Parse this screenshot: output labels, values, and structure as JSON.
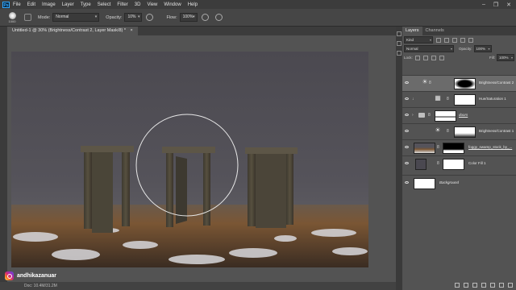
{
  "menubar": {
    "app_logo": "Ps",
    "items": [
      "File",
      "Edit",
      "Image",
      "Layer",
      "Type",
      "Select",
      "Filter",
      "3D",
      "View",
      "Window",
      "Help"
    ],
    "window_controls": [
      "–",
      "❐",
      "✕"
    ]
  },
  "options": {
    "brush_size": "1000",
    "mode_label": "Mode:",
    "mode_value": "Normal",
    "opacity_label": "Opacity:",
    "opacity_value": "10%",
    "flow_label": "Flow:",
    "flow_value": "100%"
  },
  "document": {
    "tab_title": "Untitled-1 @ 30% (Brightness/Contrast 2, Layer Mask/8) *",
    "close": "×",
    "status": "Doc: 10.4M/31.2M"
  },
  "watermark": {
    "handle": "andhikazanuar"
  },
  "layers_panel": {
    "tabs": [
      "Layers",
      "Channels"
    ],
    "kind_label": "Kind",
    "blend_mode": "Normal",
    "opacity_label": "Opacity:",
    "opacity_value": "100%",
    "lock_label": "Lock:",
    "fill_label": "Fill:",
    "fill_value": "100%",
    "layers": [
      {
        "name": "Brightness/Contrast 2",
        "icon": "brightness-icon",
        "selected": true
      },
      {
        "name": "Hue/Saturation 1",
        "icon": "hue-saturation-icon",
        "selected": false
      },
      {
        "name": "doors",
        "icon": "folder-icon",
        "selected": false
      },
      {
        "name": "Brightness/Contrast 1",
        "icon": "brightness-icon",
        "selected": false
      },
      {
        "name": "foggy_swamp_stock_by_...",
        "icon": "image-thumb",
        "selected": false
      },
      {
        "name": "Color Fill 1",
        "icon": "color-fill-icon",
        "selected": false
      },
      {
        "name": "Background",
        "icon": "background-thumb",
        "selected": false
      }
    ]
  },
  "colors": {
    "app_bg": "#535353",
    "menubar_bg": "#3c3c3c",
    "selected_layer": "#6b6b6b",
    "fog_top": "#4a4850",
    "ground": "#5a4030"
  }
}
